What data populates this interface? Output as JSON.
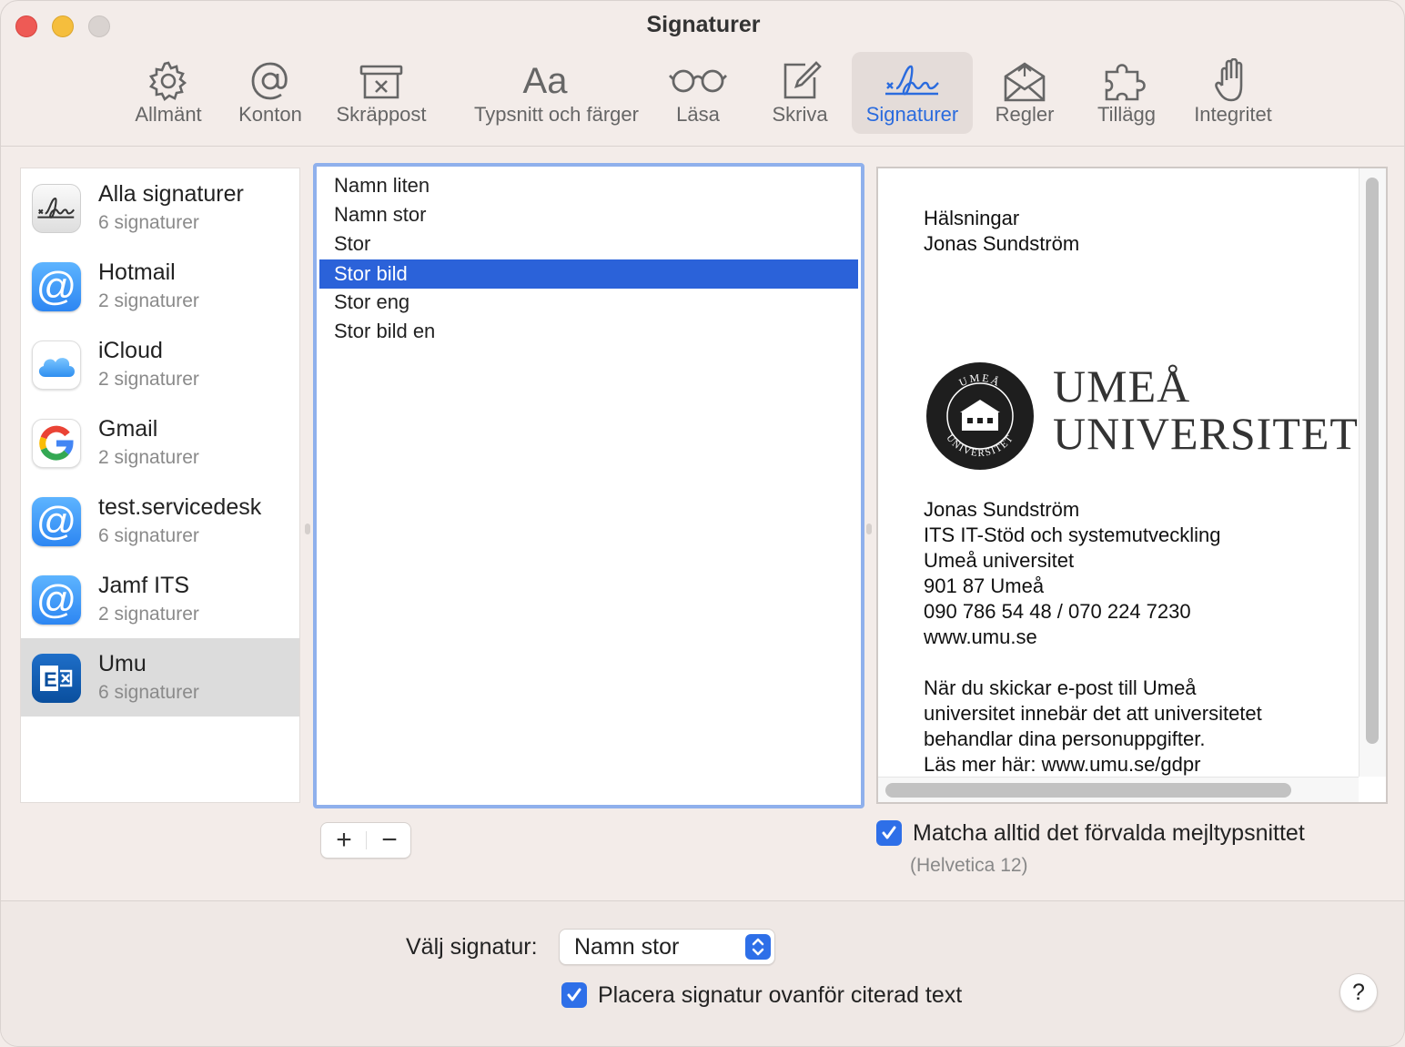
{
  "window": {
    "title": "Signaturer"
  },
  "toolbar": [
    {
      "label": "Allmänt",
      "icon": "gear-icon"
    },
    {
      "label": "Konton",
      "icon": "at-icon"
    },
    {
      "label": "Skräppost",
      "icon": "junk-icon"
    },
    {
      "label": "Typsnitt och färger",
      "icon_text": "Aa"
    },
    {
      "label": "Läsa",
      "icon": "glasses-icon"
    },
    {
      "label": "Skriva",
      "icon": "compose-icon"
    },
    {
      "label": "Signaturer",
      "icon": "signature-icon",
      "active": true
    },
    {
      "label": "Regler",
      "icon": "rules-icon"
    },
    {
      "label": "Tillägg",
      "icon": "puzzle-icon"
    },
    {
      "label": "Integritet",
      "icon": "hand-icon"
    }
  ],
  "accounts": [
    {
      "name": "Alla signaturer",
      "count": "6 signaturer",
      "icon": "signature-icon"
    },
    {
      "name": "Hotmail",
      "count": "2 signaturer",
      "icon": "at-icon",
      "icon_glyph": "@"
    },
    {
      "name": "iCloud",
      "count": "2 signaturer",
      "icon": "icloud-icon"
    },
    {
      "name": "Gmail",
      "count": "2 signaturer",
      "icon": "google-icon"
    },
    {
      "name": "test.servicedesk",
      "count": "6 signaturer",
      "icon": "at-icon",
      "icon_glyph": "@"
    },
    {
      "name": "Jamf ITS",
      "count": "2 signaturer",
      "icon": "at-icon",
      "icon_glyph": "@"
    },
    {
      "name": "Umu",
      "count": "6 signaturer",
      "icon": "exchange-icon",
      "selected": true
    }
  ],
  "signatures": [
    {
      "name": "Namn liten"
    },
    {
      "name": "Namn stor"
    },
    {
      "name": "Stor"
    },
    {
      "name": "Stor bild",
      "selected": true
    },
    {
      "name": "Stor eng"
    },
    {
      "name": "Stor bild en"
    }
  ],
  "list_buttons": {
    "add": "+",
    "remove": "−"
  },
  "preview": {
    "greeting": [
      "Hälsningar",
      "Jonas Sundström"
    ],
    "logo": {
      "line1": "UMEÅ",
      "line2": "UNIVERSITET",
      "seal_top": "UMEÅ",
      "seal_bottom": "UNIVERSITET"
    },
    "contact": [
      "Jonas Sundström",
      "ITS IT-Stöd och systemutveckling",
      "Umeå universitet",
      "901 87 Umeå",
      "090 786 54 48 / 070 224 7230",
      "www.umu.se"
    ],
    "gdpr": [
      "När du skickar e-post till Umeå",
      "universitet innebär det att universitetet",
      "behandlar dina personuppgifter.",
      "Läs mer här: www.umu.se/gdpr"
    ]
  },
  "match_font": {
    "label": "Matcha alltid det förvalda mejltypsnittet",
    "sub": "(Helvetica 12)",
    "checked": true
  },
  "choose_signature": {
    "label": "Välj signatur:",
    "value": "Namn stor"
  },
  "place_above": {
    "label": "Placera signatur ovanför citerad text",
    "checked": true
  },
  "help": {
    "label": "?"
  },
  "colors": {
    "accent": "#2b62d9",
    "focus_ring": "#8fb0ec",
    "window_bg": "#f3ece9"
  }
}
